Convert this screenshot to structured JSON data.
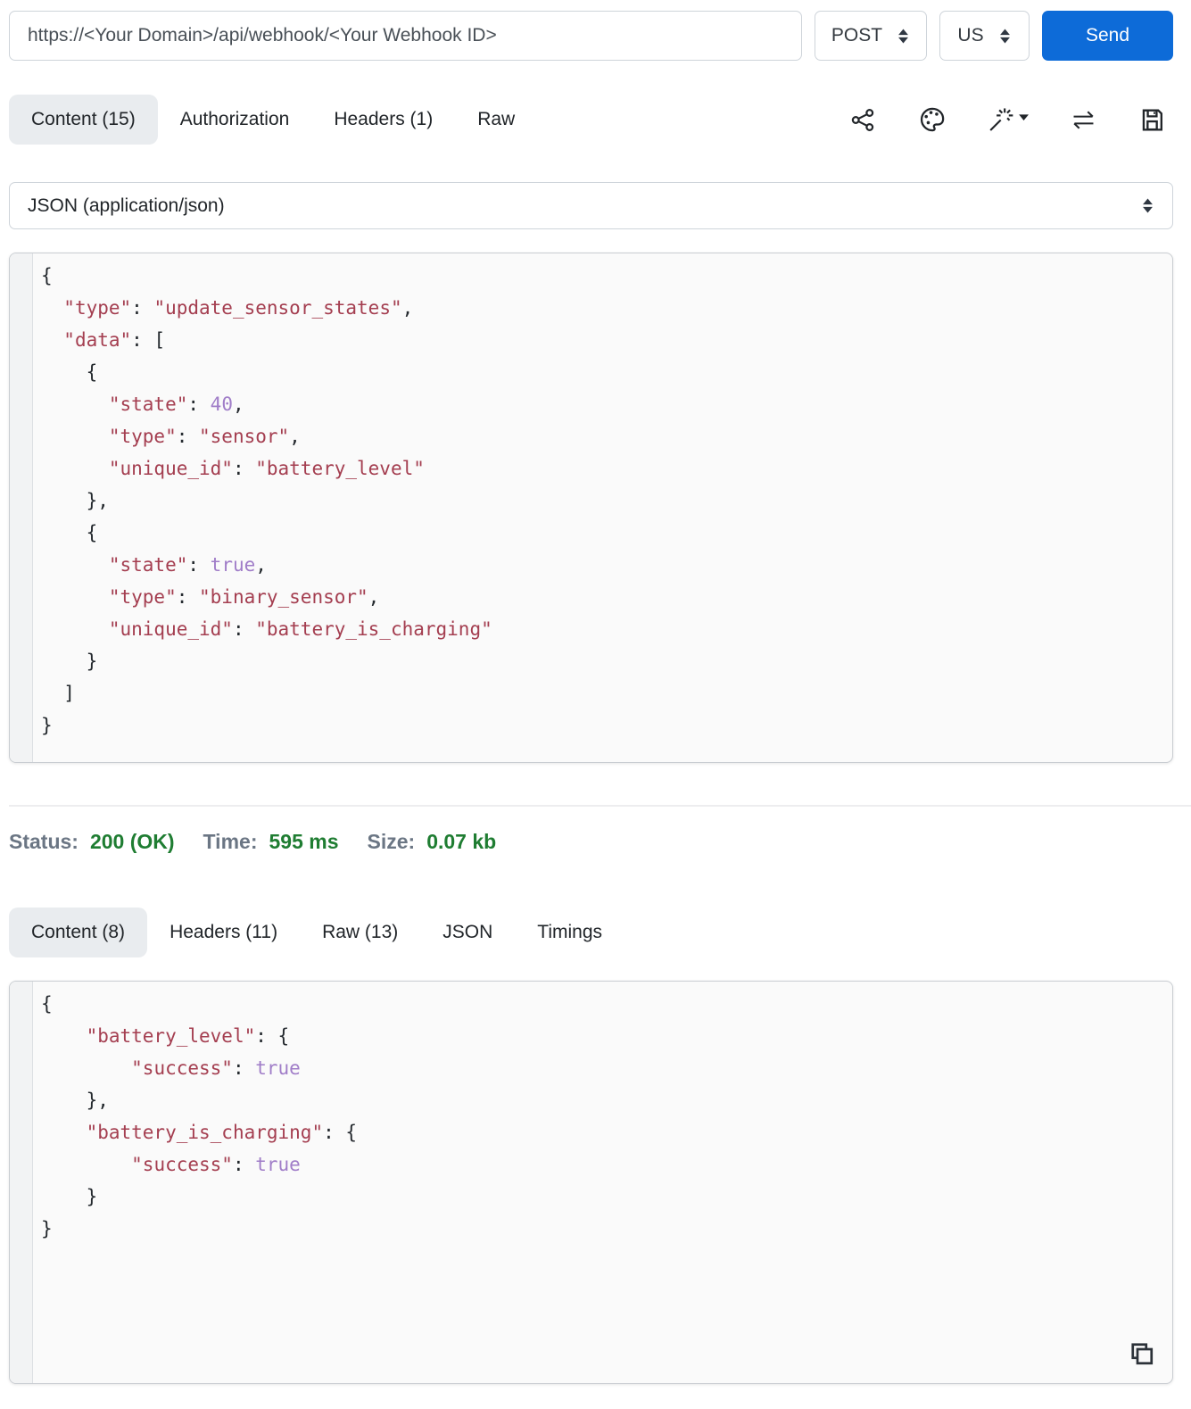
{
  "request": {
    "url": "https://<Your Domain>/api/webhook/<Your Webhook ID>",
    "method": "POST",
    "region": "US",
    "send_label": "Send",
    "tabs": [
      {
        "label": "Content (15)"
      },
      {
        "label": "Authorization"
      },
      {
        "label": "Headers (1)"
      },
      {
        "label": "Raw"
      }
    ],
    "content_type": "JSON (application/json)",
    "body_lines": [
      [
        [
          "pu",
          "{"
        ]
      ],
      [
        [
          "pu",
          "  "
        ],
        [
          "st",
          "\"type\""
        ],
        [
          "pu",
          ": "
        ],
        [
          "st",
          "\"update_sensor_states\""
        ],
        [
          "pu",
          ","
        ]
      ],
      [
        [
          "pu",
          "  "
        ],
        [
          "st",
          "\"data\""
        ],
        [
          "pu",
          ": ["
        ]
      ],
      [
        [
          "pu",
          "    {"
        ]
      ],
      [
        [
          "pu",
          "      "
        ],
        [
          "st",
          "\"state\""
        ],
        [
          "pu",
          ": "
        ],
        [
          "li",
          "40"
        ],
        [
          "pu",
          ","
        ]
      ],
      [
        [
          "pu",
          "      "
        ],
        [
          "st",
          "\"type\""
        ],
        [
          "pu",
          ": "
        ],
        [
          "st",
          "\"sensor\""
        ],
        [
          "pu",
          ","
        ]
      ],
      [
        [
          "pu",
          "      "
        ],
        [
          "st",
          "\"unique_id\""
        ],
        [
          "pu",
          ": "
        ],
        [
          "st",
          "\"battery_level\""
        ]
      ],
      [
        [
          "pu",
          "    },"
        ]
      ],
      [
        [
          "pu",
          "    {"
        ]
      ],
      [
        [
          "pu",
          "      "
        ],
        [
          "st",
          "\"state\""
        ],
        [
          "pu",
          ": "
        ],
        [
          "li",
          "true"
        ],
        [
          "pu",
          ","
        ]
      ],
      [
        [
          "pu",
          "      "
        ],
        [
          "st",
          "\"type\""
        ],
        [
          "pu",
          ": "
        ],
        [
          "st",
          "\"binary_sensor\""
        ],
        [
          "pu",
          ","
        ]
      ],
      [
        [
          "pu",
          "      "
        ],
        [
          "st",
          "\"unique_id\""
        ],
        [
          "pu",
          ": "
        ],
        [
          "st",
          "\"battery_is_charging\""
        ]
      ],
      [
        [
          "pu",
          "    }"
        ]
      ],
      [
        [
          "pu",
          "  ]"
        ]
      ],
      [
        [
          "pu",
          "}"
        ]
      ]
    ]
  },
  "response": {
    "status_label": "Status:",
    "status_value": "200 (OK)",
    "time_label": "Time:",
    "time_value": "595 ms",
    "size_label": "Size:",
    "size_value": "0.07 kb",
    "tabs": [
      {
        "label": "Content (8)"
      },
      {
        "label": "Headers (11)"
      },
      {
        "label": "Raw (13)"
      },
      {
        "label": "JSON"
      },
      {
        "label": "Timings"
      }
    ],
    "body_lines": [
      [
        [
          "pu",
          "{"
        ]
      ],
      [
        [
          "pu",
          "    "
        ],
        [
          "st",
          "\"battery_level\""
        ],
        [
          "pu",
          ": {"
        ]
      ],
      [
        [
          "pu",
          "        "
        ],
        [
          "st",
          "\"success\""
        ],
        [
          "pu",
          ": "
        ],
        [
          "li",
          "true"
        ]
      ],
      [
        [
          "pu",
          "    },"
        ]
      ],
      [
        [
          "pu",
          "    "
        ],
        [
          "st",
          "\"battery_is_charging\""
        ],
        [
          "pu",
          ": {"
        ]
      ],
      [
        [
          "pu",
          "        "
        ],
        [
          "st",
          "\"success\""
        ],
        [
          "pu",
          ": "
        ],
        [
          "li",
          "true"
        ]
      ],
      [
        [
          "pu",
          "    }"
        ]
      ],
      [
        [
          "pu",
          "}"
        ]
      ]
    ]
  },
  "icons": [
    "share-icon",
    "palette-icon",
    "magic-wand-icon",
    "caret-down-icon",
    "swap-arrows-icon",
    "save-icon",
    "copy-icon",
    "method-updown-icon",
    "region-updown-icon",
    "content-type-updown-icon"
  ],
  "colors": {
    "accent_blue": "#0d6bd8",
    "status_green": "#1f7d32",
    "status_label_grey": "#6b7684",
    "code_string": "#a43e50",
    "code_literal": "#a07dc8",
    "code_punct": "#24292e",
    "active_tab_bg": "#e9ecef"
  }
}
